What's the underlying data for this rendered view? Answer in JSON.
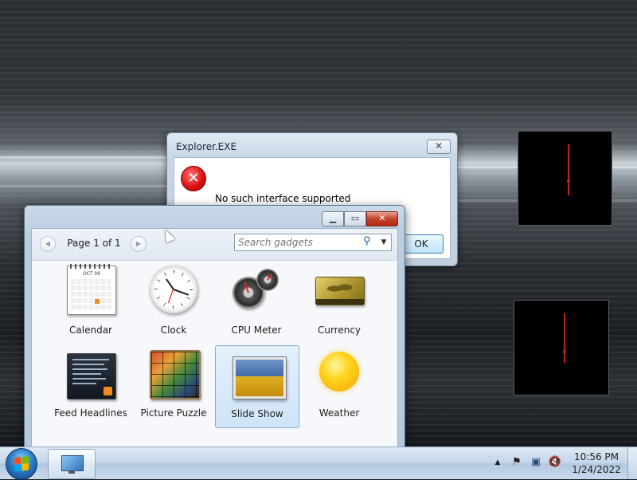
{
  "error_dialog": {
    "title": "Explorer.EXE",
    "close_glyph": "✕",
    "icon": "error-icon",
    "icon_glyph": "✕",
    "message": "No such interface supported",
    "ok_label": "OK"
  },
  "gadgets_window": {
    "caption_buttons": {
      "minimize": "▁",
      "maximize": "▭",
      "close": "✕"
    },
    "pager": {
      "prev_glyph": "◀",
      "label": "Page 1 of 1",
      "next_glyph": "▶"
    },
    "search": {
      "placeholder": "Search gadgets",
      "icon": "search-icon",
      "icon_glyph": "⚲",
      "dropdown_glyph": "▼"
    },
    "gadgets": [
      {
        "label": "Calendar",
        "icon": "calendar-icon",
        "month": "OCT 06"
      },
      {
        "label": "Clock",
        "icon": "clock-icon"
      },
      {
        "label": "CPU Meter",
        "icon": "cpu-meter-icon"
      },
      {
        "label": "Currency",
        "icon": "currency-icon"
      },
      {
        "label": "Feed Headlines",
        "icon": "feed-headlines-icon"
      },
      {
        "label": "Picture Puzzle",
        "icon": "picture-puzzle-icon"
      },
      {
        "label": "Slide Show",
        "icon": "slide-show-icon",
        "selected": true
      },
      {
        "label": "Weather",
        "icon": "weather-icon"
      }
    ]
  },
  "taskbar": {
    "start_icon": "windows-start-icon",
    "pinned_app_icon": "computer-monitor-icon",
    "tray": {
      "show_hidden_glyph": "▲",
      "flag_glyph": "⚑",
      "network_glyph": "▣",
      "volume_glyph": "🔇"
    },
    "time": "10:56 PM",
    "date": "1/24/2022"
  },
  "colors": {
    "taskbar": "#c3d6ea",
    "selection": "#cfe4f8",
    "gadget_line": "#c71f1f",
    "error_red": "#d11111"
  }
}
